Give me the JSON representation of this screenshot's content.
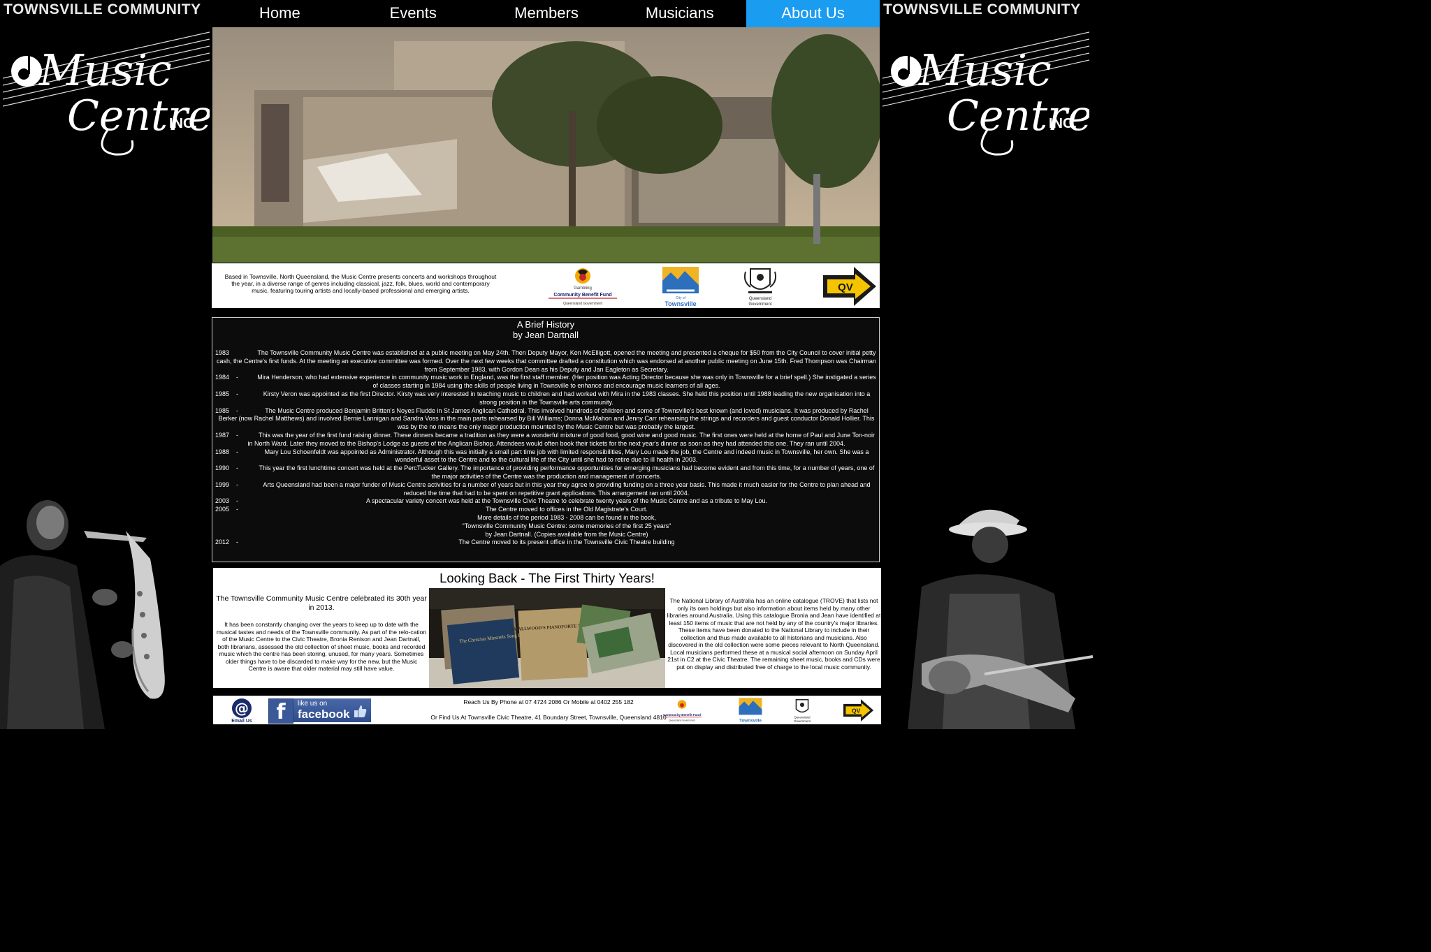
{
  "brand": {
    "title": "TOWNSVILLE COMMUNITY",
    "logo_line1": "Music",
    "logo_line2": "Centre",
    "logo_inc": "INC."
  },
  "nav": {
    "items": [
      "Home",
      "Events",
      "Members",
      "Musicians",
      "About Us"
    ],
    "active": "About Us",
    "active_color": "#1a9cf0"
  },
  "intro": {
    "text": "Based in Townsville, North Queensland, the Music Centre presents concerts and workshops throughout the year, in a diverse range of genres including classical, jazz, folk, blues, world and contemporary music, featuring touring artists and locally-based professional and emerging artists."
  },
  "sponsors": {
    "gambling_line1": "Gambling",
    "gambling_line2": "Community Benefit Fund",
    "gambling_line3": "Queensland Government",
    "city_line1": "City of",
    "city_line2": "Townsville",
    "qld_line1": "Queensland",
    "qld_line2": "Government",
    "arts_label": "QV"
  },
  "history": {
    "title": "A Brief History",
    "subtitle": "by Jean Dartnall",
    "entries": [
      {
        "year": "1983",
        "dash": "",
        "text": "The Townsville Community Music Centre was established at a public meeting on May 24th. Then Deputy Mayor, Ken McElligott, opened the meeting and presented a cheque for $50 from the City Council to cover initial petty cash, the Centre's first funds. At the meeting an executive committee was formed. Over the next few weeks that committee drafted a constitution which was endorsed at another public meeting on June 15th. Fred Thompson was Chairman from September 1983, with Gordon Dean as his Deputy and Jan Eagleton as Secretary."
      },
      {
        "year": "1984",
        "dash": "-",
        "text": "Mira Henderson, who had extensive experience in community music work in England, was the first staff member. (Her position was Acting Director because she was only in Townsville for a brief spell.) She instigated a series of classes starting in 1984 using the skills of people living in Townsville to enhance and encourage music learners of all ages."
      },
      {
        "year": "1985",
        "dash": "-",
        "text": "Kirsty Veron was appointed as the first Director. Kirsty was very interested in teaching music to children and had worked with Mira in the 1983 classes. She held this position until 1988 leading the new organisation into a strong position in the Townsville arts community."
      },
      {
        "year": "1985",
        "dash": "-",
        "text": "The Music Centre produced Benjamin Britten's Noyes Fludde in St James Anglican Cathedral. This involved hundreds of children and some of Townsville's best known (and loved) musicians. It was produced by Rachel Berker (now Rachel Matthews) and involved Bernie Lannigan and Sandra Voss in the main parts rehearsed by Bill Williams; Donna McMahon and Jenny Carr rehearsing the strings and recorders and guest conductor Donald Hollier. This was by the no means the only major production mounted by the Music Centre but was probably the largest."
      },
      {
        "year": "1987",
        "dash": "-",
        "text": "This was the year of the first fund raising dinner. These dinners became a tradition as they were a wonderful mixture of good food, good wine and good music. The first ones were held at the home of Paul and June Ton-noir in North Ward. Later they moved to the Bishop's Lodge as guests of the Anglican Bishop. Attendees would often book their tickets for the next year's dinner as soon as they had attended this one. They ran until 2004."
      },
      {
        "year": "1988",
        "dash": "-",
        "text": "Mary Lou Schoenfeldt was appointed as Administrator. Although this was initially a small part time job with limited responsibilities, Mary Lou made the job, the Centre and indeed music in Townsville, her own. She was a wonderful asset to the Centre and to the cultural life of the City until she had to retire due to ill health in 2003."
      },
      {
        "year": "1990",
        "dash": "-",
        "text": "This year the first lunchtime concert was held at the PercTucker Gallery. The importance of providing performance opportunities for emerging musicians had become evident and from this time, for a number of years, one of the major activities of the Centre was the production and management of concerts."
      },
      {
        "year": "1999",
        "dash": "-",
        "text": "Arts Queensland had been a major funder of Music Centre activities for a number of years but in this year they agree to providing funding on a three year basis. This made it much easier for the Centre to plan ahead and reduced the time that had to be spent on repetitive grant applications. This arrangement ran until 2004."
      },
      {
        "year": "2003",
        "dash": "-",
        "text": "A spectacular variety concert was held at the Townsville Civic Theatre to celebrate twenty years of the Music Centre and as a tribute to May Lou."
      },
      {
        "year": "2005",
        "dash": "-",
        "text": "The Centre moved to offices in the Old Magistrate's Court."
      },
      {
        "year": "",
        "dash": "",
        "text": "More details of the period 1983 - 2008 can be found in the book,"
      },
      {
        "year": "",
        "dash": "",
        "text": "\"Townsville Community Music Centre: some memories of the first 25 years\""
      },
      {
        "year": "",
        "dash": "",
        "text": "by Jean Dartnall. (Copies available from the Music Centre)"
      },
      {
        "year": "2012",
        "dash": "-",
        "text": "The Centre moved to its present office in the Townsville Civic Theatre building"
      }
    ]
  },
  "lookback": {
    "title": "Looking Back - The First Thirty Years!",
    "lead": "The Townsville Community Music Centre celebrated its 30th year in 2013.",
    "left_body": "It has been constantly changing over the years to keep up to date with the musical tastes and needs of the Townsville community. As part of the relo-cation of the Music Centre to the Civic Theatre, Bronia Renison and Jean Dartnall, both librarians, assessed the old collection of sheet music, books and recorded music which the centre has been storing, unused, for many years. Sometimes older things have to be discarded to make way for the new, but the Music Centre is aware that older material may still have value.",
    "right_body": "The National Library of Australia has an online catalogue (TROVE) that lists not only its own holdings but also information about items held by many other libraries around Australia. Using this catalogue Bronia and Jean have identified at least 150 items of music that are not held by any of the country's major libraries. These items have been donated to the National Library to include in their collection and thus made available to all historians and musicians. Also discovered in the old collection were some pieces relevant to North Queensland. Local musicians performed these at a musical social afternoon on Sunday April 21st in C2 at the Civic Theatre. The remaining sheet music, books and CDs were put on display and distributed free of charge to the local music community.",
    "book1": "The Christian Minstrels Song Book",
    "book2": "SMALLWOOD'S PIANOFORTE TUTOR"
  },
  "footer": {
    "email_label": "Email Us",
    "fb_like": "like us on",
    "fb_name": "facebook",
    "contact_line1": "Reach Us By Phone at 07 4724 2086 Or Mobile at 0402 255 182",
    "contact_line2": "Or Find Us At Townsville Civic Theatre, 41 Boundary Street, Townsville, Queensland 4810"
  }
}
